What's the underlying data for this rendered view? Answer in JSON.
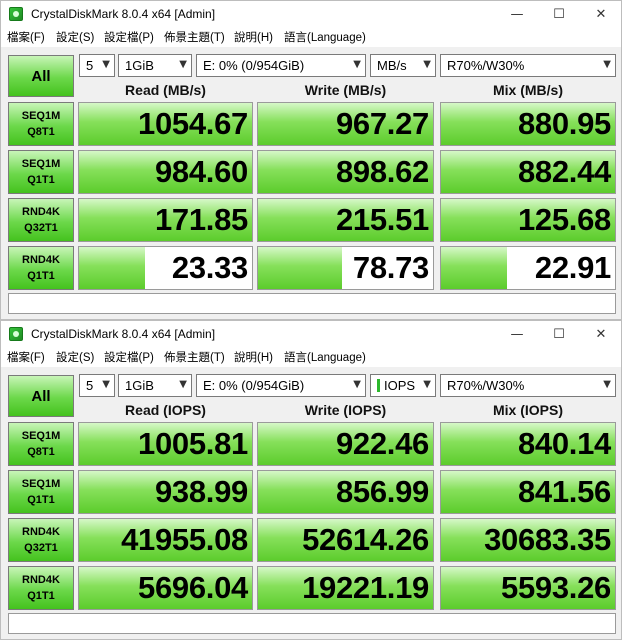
{
  "windows": [
    {
      "title": "CrystalDiskMark 8.0.4 x64 [Admin]",
      "menu": [
        "檔案(F)",
        "設定(S)",
        "設定檔(P)",
        "佈景主題(T)",
        "說明(H)",
        "語言(Language)"
      ],
      "controls": {
        "all_label": "All",
        "count": "5",
        "size": "1GiB",
        "drive": "E: 0% (0/954GiB)",
        "unit": "MB/s",
        "mix": "R70%/W30%"
      },
      "headers": {
        "read": "Read (MB/s)",
        "write": "Write (MB/s)",
        "mix": "Mix (MB/s)"
      },
      "rows": [
        {
          "line1": "SEQ1M",
          "line2": "Q8T1",
          "read": "1054.67",
          "write": "967.27",
          "mix": "880.95"
        },
        {
          "line1": "SEQ1M",
          "line2": "Q1T1",
          "read": "984.60",
          "write": "898.62",
          "mix": "882.44"
        },
        {
          "line1": "RND4K",
          "line2": "Q32T1",
          "read": "171.85",
          "write": "215.51",
          "mix": "125.68"
        },
        {
          "line1": "RND4K",
          "line2": "Q1T1",
          "read": "23.33",
          "write": "78.73",
          "mix": "22.91"
        }
      ],
      "bar_fill_fractions": [
        {
          "read": 1.0,
          "write": 1.0,
          "mix": 1.0
        },
        {
          "read": 1.0,
          "write": 1.0,
          "mix": 1.0
        },
        {
          "read": 1.0,
          "write": 1.0,
          "mix": 1.0
        },
        {
          "read": 0.38,
          "write": 0.48,
          "mix": 0.38
        }
      ],
      "comment": ""
    },
    {
      "title": "CrystalDiskMark 8.0.4 x64 [Admin]",
      "menu": [
        "檔案(F)",
        "設定(S)",
        "設定檔(P)",
        "佈景主題(T)",
        "說明(H)",
        "語言(Language)"
      ],
      "controls": {
        "all_label": "All",
        "count": "5",
        "size": "1GiB",
        "drive": "E: 0% (0/954GiB)",
        "unit": "IOPS",
        "mix": "R70%/W30%"
      },
      "headers": {
        "read": "Read (IOPS)",
        "write": "Write (IOPS)",
        "mix": "Mix (IOPS)"
      },
      "rows": [
        {
          "line1": "SEQ1M",
          "line2": "Q8T1",
          "read": "1005.81",
          "write": "922.46",
          "mix": "840.14"
        },
        {
          "line1": "SEQ1M",
          "line2": "Q1T1",
          "read": "938.99",
          "write": "856.99",
          "mix": "841.56"
        },
        {
          "line1": "RND4K",
          "line2": "Q32T1",
          "read": "41955.08",
          "write": "52614.26",
          "mix": "30683.35"
        },
        {
          "line1": "RND4K",
          "line2": "Q1T1",
          "read": "5696.04",
          "write": "19221.19",
          "mix": "5593.26"
        }
      ],
      "bar_fill_fractions": [
        {
          "read": 1.0,
          "write": 1.0,
          "mix": 1.0
        },
        {
          "read": 1.0,
          "write": 1.0,
          "mix": 1.0
        },
        {
          "read": 1.0,
          "write": 1.0,
          "mix": 1.0
        },
        {
          "read": 1.0,
          "write": 1.0,
          "mix": 1.0
        }
      ],
      "comment": ""
    }
  ],
  "icons": {
    "app": "crystaldiskmark-app-icon",
    "minimize": "minimize-icon",
    "maximize": "maximize-icon",
    "close": "close-icon",
    "dropdown": "chevron-down-icon"
  },
  "colors": {
    "bar_green": "#5ccc2c",
    "button_green": "#44c21e"
  }
}
